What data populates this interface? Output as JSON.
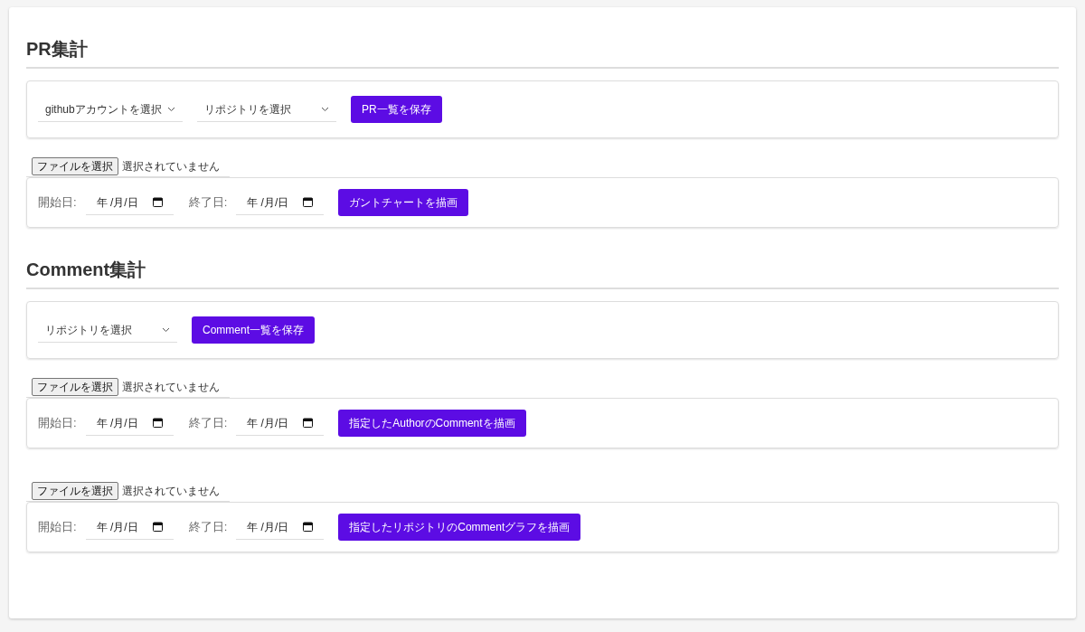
{
  "sections": [
    {
      "title": "PR集計",
      "selects": [
        {
          "placeholder": "githubアカウントを選択"
        },
        {
          "placeholder": "リポジトリを選択"
        }
      ],
      "save_button": "PR一覧を保存",
      "uploads": [
        {
          "file_button": "ファイルを選択",
          "file_status": "選択されていません",
          "start_label": "開始日:",
          "start_value": "年 /月/日",
          "end_label": "終了日:",
          "end_value": "年 /月/日",
          "draw_button": "ガントチャートを描画"
        }
      ]
    },
    {
      "title": "Comment集計",
      "selects": [
        {
          "placeholder": "リポジトリを選択"
        }
      ],
      "save_button": "Comment一覧を保存",
      "uploads": [
        {
          "file_button": "ファイルを選択",
          "file_status": "選択されていません",
          "start_label": "開始日:",
          "start_value": "年 /月/日",
          "end_label": "終了日:",
          "end_value": "年 /月/日",
          "draw_button": "指定したAuthorのCommentを描画"
        },
        {
          "file_button": "ファイルを選択",
          "file_status": "選択されていません",
          "start_label": "開始日:",
          "start_value": "年 /月/日",
          "end_label": "終了日:",
          "end_value": "年 /月/日",
          "draw_button": "指定したリポジトリのCommentグラフを描画"
        }
      ]
    }
  ]
}
